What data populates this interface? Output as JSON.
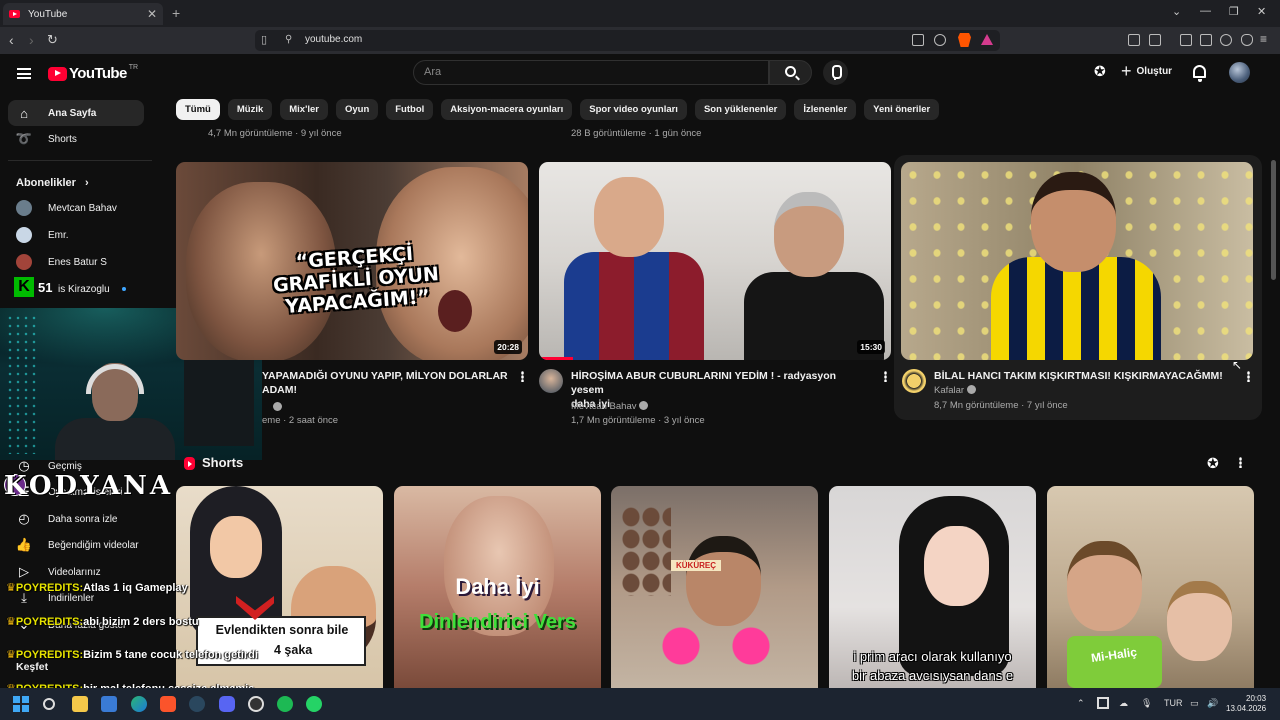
{
  "browser": {
    "tab_title": "YouTube",
    "url": "youtube.com"
  },
  "header": {
    "logo_text": "YouTube",
    "country_code": "TR",
    "search_placeholder": "Ara",
    "create_label": "Oluştur"
  },
  "sidebar": {
    "home": "Ana Sayfa",
    "shorts": "Shorts",
    "subscriptions_heading": "Abonelikler",
    "channels": [
      "Mevtcan Bahav",
      "Emr.",
      "Enes Batur S",
      "is Kirazoglu"
    ],
    "you_items": [
      "Geçmiş",
      "Oynatma listeleri",
      "Daha sonra izle",
      "Beğendiğim videolar",
      "Videolarınız",
      "İndirilenler",
      "Daha fazla göster"
    ],
    "explore": "Keşfet"
  },
  "chips": [
    "Tümü",
    "Müzik",
    "Mix'ler",
    "Oyun",
    "Futbol",
    "Aksiyon-macera oyunları",
    "Spor video oyunları",
    "Son yüklenenler",
    "İzlenenler",
    "Yeni öneriler"
  ],
  "previous_row_meta": [
    "4,7 Mn görüntüleme · 9 yıl önce",
    "28 B görüntüleme · 1 gün önce"
  ],
  "videos": [
    {
      "thumb_text": "“GERÇEKÇİ GRAFİKLİ OYUN YAPACAĞIM!”",
      "duration": "20:28",
      "title_line1": "YAPAMADIĞI OYUNU YAPIP, MİLYON DOLARLAR",
      "title_line2": "ADAM!",
      "meta": "eme · 2 saat önce"
    },
    {
      "duration": "15:30",
      "title_line1": "HİROŞİMA ABUR CUBURLARINI YEDİM ! - radyasyon yesem",
      "title_line2": "daha iyi",
      "channel": "Mevtcan Bahav",
      "meta": "1,7 Mn görüntüleme · 3 yıl önce"
    },
    {
      "title_line1": "BİLAL HANCI TAKIM KIŞKIRTMASI! KIŞKIRMAYACAĞMM!",
      "channel": "Kafalar",
      "meta": "8,7 Mn görüntüleme · 7 yıl önce"
    }
  ],
  "shorts_section": {
    "title": "Shorts",
    "items": [
      {
        "caption_line1": "Evlendikten sonra bile",
        "caption_line2": "4 şaka"
      },
      {
        "caption_line1": "Daha İyi",
        "caption_line2": "Dinlendirici Vers"
      },
      {
        "caption_line1": "KÜKÜREÇ"
      },
      {
        "caption_line1": "i prim aracı olarak kullanıyo",
        "caption_line2": "bir abaza avcısıysan dans e"
      },
      {
        "caption_line1": "Mi-Haliç"
      }
    ]
  },
  "stream_overlay": {
    "badge_number": "51",
    "brand": "KODYANA",
    "chat": [
      {
        "user": "POYREDITS:",
        "msg": "Atlas 1 iq Gameplay"
      },
      {
        "user": "POYREDITS:",
        "msg": "abi bizim 2 ders bostu"
      },
      {
        "user": "POYREDITS:",
        "msg": "Bizim 5 tane cocuk telefon getirdi"
      },
      {
        "user": "POYREDITS:",
        "msg": "bir mal telefonu sessize almamis"
      }
    ]
  },
  "taskbar": {
    "lang": "TUR",
    "time": "20:03",
    "date": "13.04.2026"
  },
  "colors": {
    "background": "#0f0f0f",
    "accent": "#ff0033",
    "chat_user": "#e7e300"
  }
}
